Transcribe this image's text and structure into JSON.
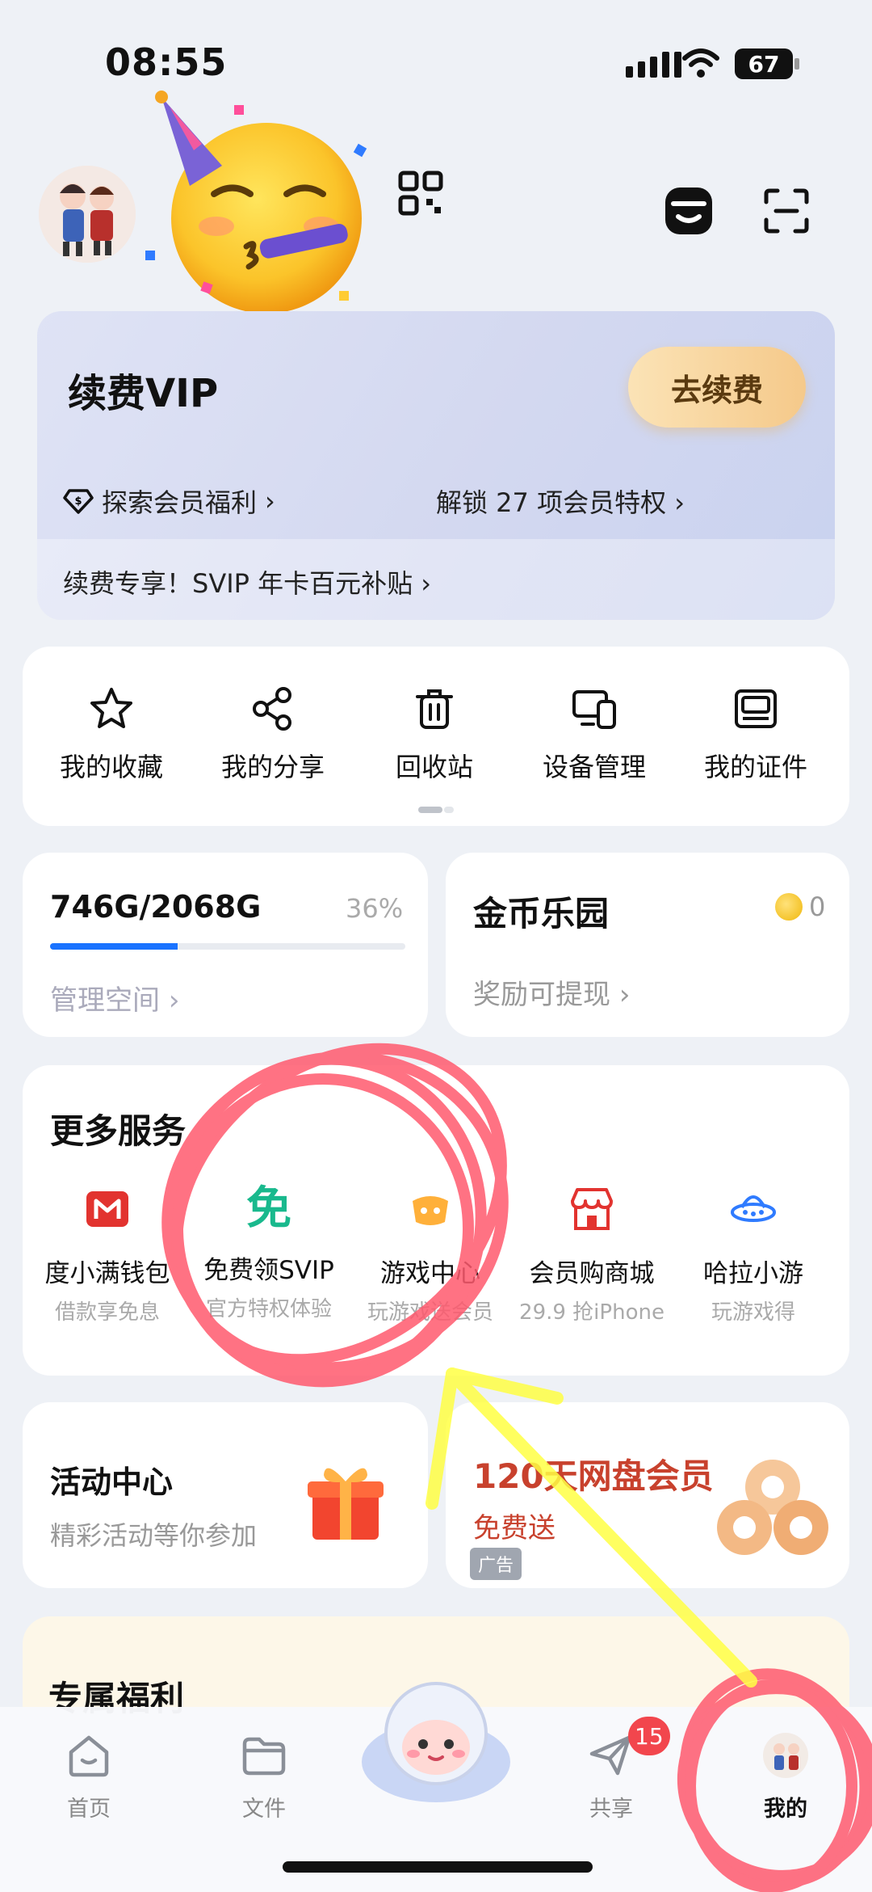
{
  "status_bar": {
    "time": "08:55",
    "battery": "67"
  },
  "vip": {
    "title": "续费VIP",
    "renew_button": "去续费",
    "explore_link": "探索会员福利",
    "unlock_link": "解锁 27 项会员特权",
    "promo": "续费专享！SVIP 年卡百元补贴"
  },
  "quick_actions": [
    {
      "label": "我的收藏",
      "icon": "star-icon"
    },
    {
      "label": "我的分享",
      "icon": "share-icon"
    },
    {
      "label": "回收站",
      "icon": "trash-icon"
    },
    {
      "label": "设备管理",
      "icon": "devices-icon"
    },
    {
      "label": "我的证件",
      "icon": "id-card-icon"
    }
  ],
  "storage": {
    "usage": "746G/2068G",
    "percent": "36%",
    "fill_fraction": 0.36,
    "manage_label": "管理空间"
  },
  "coins": {
    "title": "金币乐园",
    "count": "0",
    "sub": "奖励可提现"
  },
  "services": {
    "title": "更多服务",
    "items": [
      {
        "name": "度小满钱包",
        "desc": "借款享免息",
        "icon": "wallet-icon"
      },
      {
        "name": "免费领SVIP",
        "desc": "官方特权体验",
        "icon": "free-icon",
        "glyph": "免"
      },
      {
        "name": "游戏中心",
        "desc": "玩游戏送会员",
        "icon": "game-icon"
      },
      {
        "name": "会员购商城",
        "desc": "29.9 抢iPhone",
        "icon": "store-icon"
      },
      {
        "name": "哈拉小游",
        "desc": "玩游戏得",
        "icon": "ufo-icon"
      }
    ]
  },
  "activity": {
    "title": "活动中心",
    "sub": "精彩活动等你参加"
  },
  "ad": {
    "title": "120天网盘会员",
    "sub": "免费送",
    "tag": "广告"
  },
  "benefits": {
    "title": "专属福利"
  },
  "tabbar": {
    "items": [
      {
        "label": "首页",
        "icon": "home-icon"
      },
      {
        "label": "文件",
        "icon": "folder-icon"
      },
      {
        "label": "共享",
        "icon": "send-icon"
      },
      {
        "label": "我的",
        "icon": "profile-avatar-icon"
      }
    ],
    "share_badge": "15"
  },
  "colors": {
    "accent": "#1a73ff",
    "ad_red": "#c8412d",
    "annotation_red": "#ff5a6e",
    "annotation_yellow": "#ffff44"
  }
}
